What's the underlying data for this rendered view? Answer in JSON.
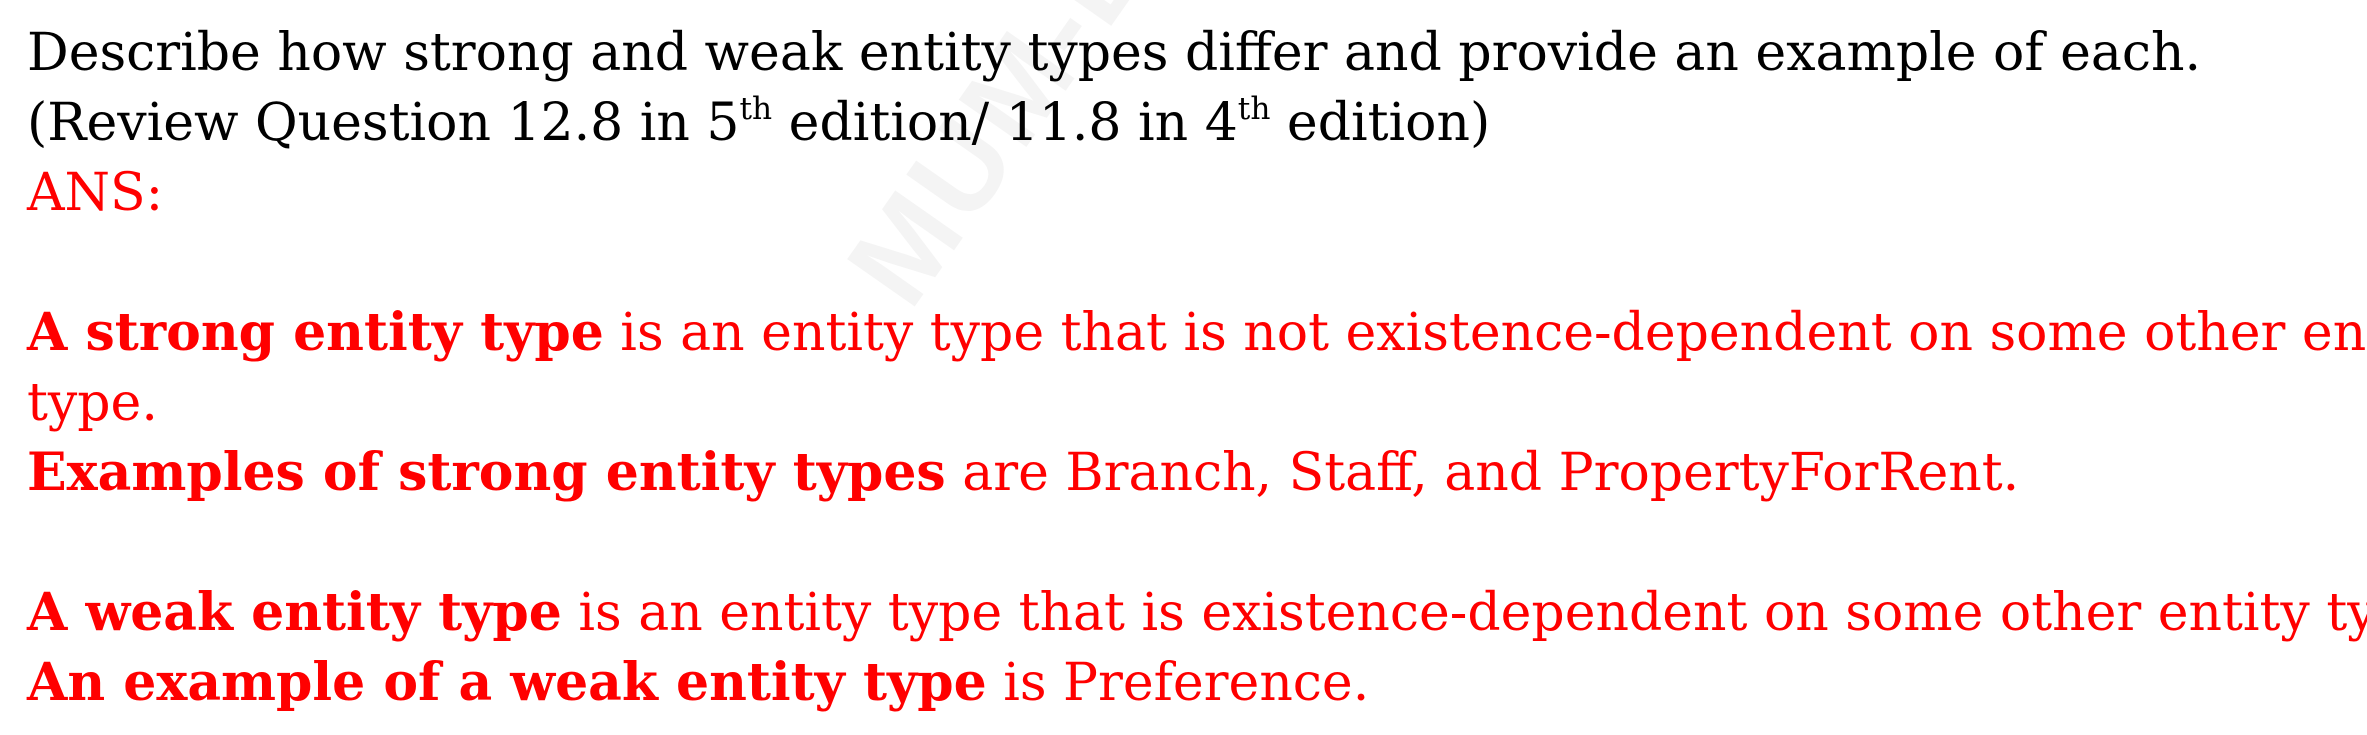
{
  "watermark": "MUM-BRN",
  "question": {
    "line1": "Describe how strong and weak entity types differ and provide an example of each.",
    "line2_part1": "(Review Question 12.8 in 5",
    "line2_sup1": "th",
    "line2_part2": " edition/ 11.8 in 4",
    "line2_sup2": "th",
    "line2_part3": " edition)"
  },
  "answer": {
    "label": "ANS:",
    "strong": {
      "term": "A strong entity type",
      "definition_line1": " is an entity type that is not existence-dependent on some other entity",
      "definition_line2": "type.",
      "examples_term": "Examples of strong entity types",
      "examples_text": " are Branch, Staff, and PropertyForRent."
    },
    "weak": {
      "term": "A weak entity type",
      "definition": " is an entity type that is existence-dependent on some other entity type.",
      "example_term": "An example of a weak entity type",
      "example_text": " is Preference."
    }
  },
  "colors": {
    "question": "#000000",
    "answer": "#ff0000"
  }
}
